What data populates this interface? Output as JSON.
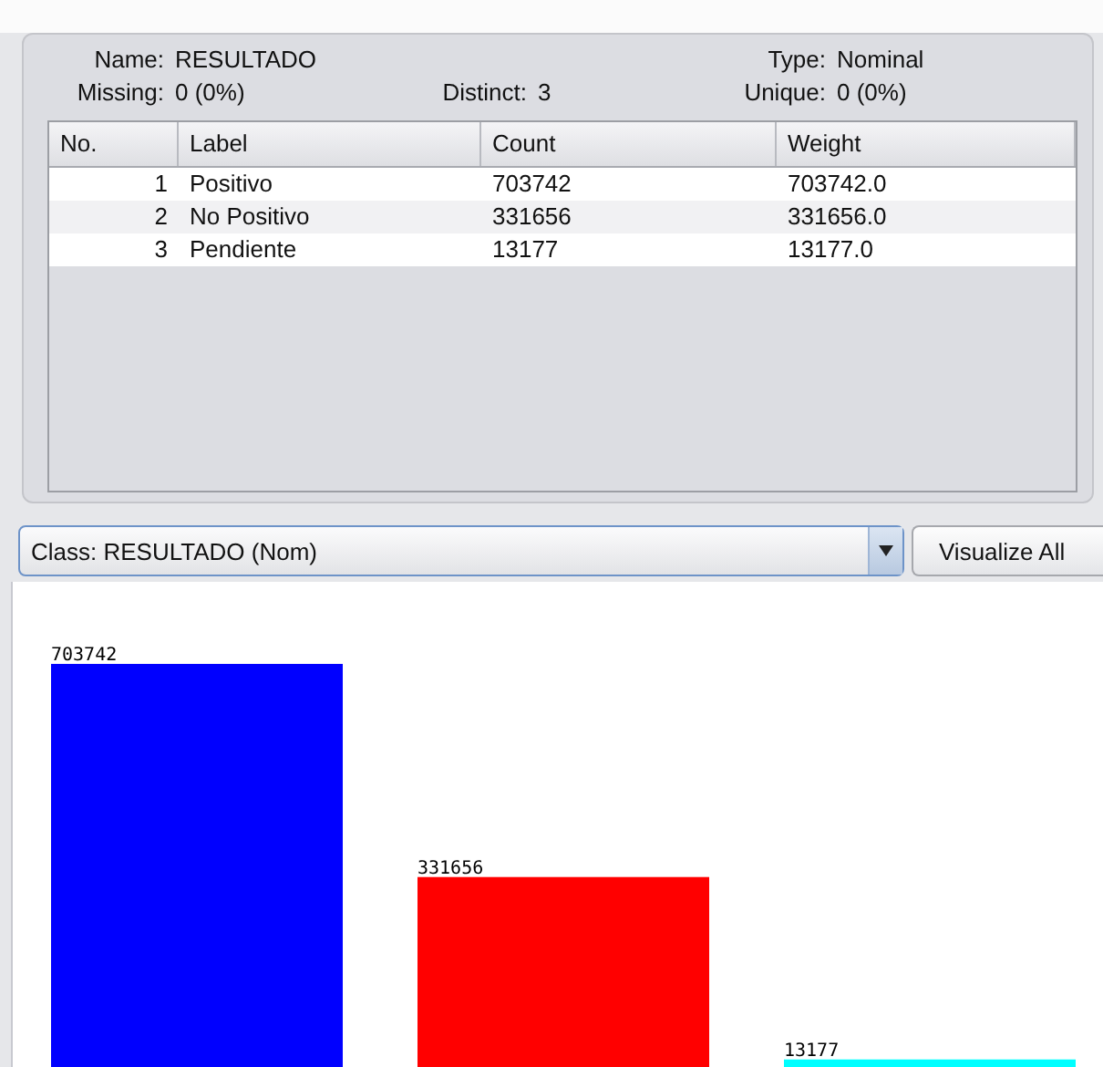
{
  "attribute": {
    "name": {
      "label": "Name:",
      "value": "RESULTADO"
    },
    "type": {
      "label": "Type:",
      "value": "Nominal"
    },
    "missing": {
      "label": "Missing:",
      "value": "0 (0%)"
    },
    "distinct": {
      "label": "Distinct:",
      "value": "3"
    },
    "unique": {
      "label": "Unique:",
      "value": "0 (0%)"
    }
  },
  "table": {
    "columns": [
      "No.",
      "Label",
      "Count",
      "Weight"
    ],
    "rows": [
      [
        "1",
        "Positivo",
        "703742",
        "703742.0"
      ],
      [
        "2",
        "No Positivo",
        "331656",
        "331656.0"
      ],
      [
        "3",
        "Pendiente",
        "13177",
        "13177.0"
      ]
    ]
  },
  "class_select": {
    "value": "Class: RESULTADO (Nom)"
  },
  "visualize_button": {
    "label": "Visualize All"
  },
  "chart_data": {
    "type": "bar",
    "data_labels": true,
    "series": [
      {
        "color": "#0000ff",
        "values": [
          703742
        ]
      },
      {
        "color": "#ff0000",
        "values": [
          331656
        ]
      },
      {
        "color": "#00ffff",
        "values": [
          13177
        ]
      }
    ]
  }
}
